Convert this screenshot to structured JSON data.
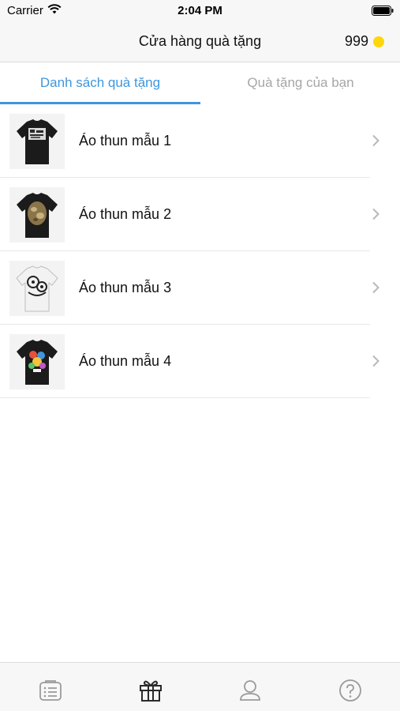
{
  "status_bar": {
    "carrier": "Carrier",
    "time": "2:04 PM",
    "icons": [
      "wifi-icon",
      "battery-icon"
    ]
  },
  "header": {
    "title": "Cửa hàng quà tặng",
    "coins": "999",
    "coin_color": "#ffd60a"
  },
  "tabs": [
    {
      "label": "Danh sách quà tặng",
      "active": true
    },
    {
      "label": "Quà tặng của bạn",
      "active": false
    }
  ],
  "accent_color": "#3f96dd",
  "items": [
    {
      "label": "Áo thun mẫu 1",
      "image": "black-tshirt-white-print"
    },
    {
      "label": "Áo thun mẫu 2",
      "image": "black-tshirt-gold-print"
    },
    {
      "label": "Áo thun mẫu 3",
      "image": "white-tshirt-black-print"
    },
    {
      "label": "Áo thun mẫu 4",
      "image": "black-tshirt-color-print"
    }
  ],
  "bottom_tabs": [
    {
      "icon": "list-icon",
      "active": false
    },
    {
      "icon": "gift-icon",
      "active": true
    },
    {
      "icon": "profile-icon",
      "active": false
    },
    {
      "icon": "help-icon",
      "active": false
    }
  ]
}
